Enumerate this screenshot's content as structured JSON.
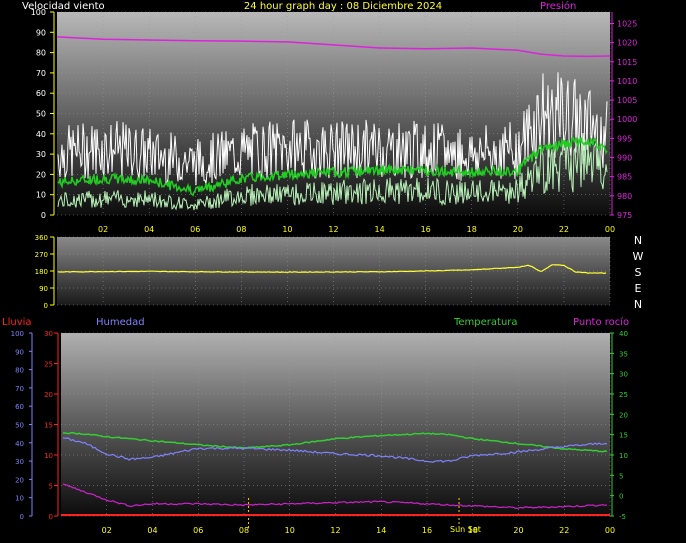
{
  "header": {
    "wind_label": "Velocidad viento",
    "title": "24 hour graph day : 08 Diciembre 2024",
    "pressure_label": "Presión"
  },
  "lower_header": {
    "rain_label": "Lluvia",
    "humidity_label": "Humedad",
    "temperature_label": "Temperatura",
    "dewpoint_label": "Punto rocío"
  },
  "colors": {
    "wind_gust": "#ffffff",
    "wind_avg": "#22cc22",
    "wind_light": "#b8f0b8",
    "pressure": "#dd22dd",
    "direction": "#ffff33",
    "humidity": "#8080ff",
    "temperature": "#33cc33",
    "dewpoint": "#cc22cc",
    "rain": "#ff2222",
    "x_ticks": "#ffff00"
  },
  "x_tick_labels": [
    "02",
    "04",
    "06",
    "08",
    "10",
    "12",
    "14",
    "16",
    "18",
    "20",
    "22",
    "00"
  ],
  "sunset_label": "Sun Set",
  "chart_data": [
    {
      "type": "line",
      "name": "wind-pressure",
      "ylim": [
        0,
        100
      ],
      "y_ticks": [
        0,
        10,
        20,
        30,
        40,
        50,
        60,
        70,
        80,
        90,
        100
      ],
      "y2lim": [
        975,
        1028
      ],
      "y2_ticks": [
        975,
        980,
        985,
        990,
        995,
        1000,
        1005,
        1010,
        1015,
        1020,
        1025
      ],
      "x_hours": [
        0,
        2,
        4,
        6,
        8,
        10,
        12,
        14,
        16,
        18,
        20,
        21,
        22,
        23,
        24
      ],
      "series": [
        {
          "name": "Velocidad viento",
          "role": "gust",
          "values": [
            30,
            33,
            30,
            26,
            31,
            33,
            32,
            33,
            32,
            30,
            32,
            50,
            48,
            45,
            38
          ]
        },
        {
          "name": "",
          "role": "avg",
          "values": [
            16,
            18,
            17,
            12,
            18,
            20,
            21,
            22,
            22,
            21,
            22,
            33,
            35,
            37,
            32
          ]
        },
        {
          "name": "",
          "role": "min",
          "values": [
            7,
            8,
            8,
            5,
            10,
            10,
            11,
            12,
            12,
            11,
            12,
            22,
            24,
            26,
            20
          ]
        },
        {
          "name": "Presión",
          "role": "pressure",
          "values": [
            1021.5,
            1020.9,
            1020.7,
            1020.5,
            1020.4,
            1020.2,
            1019.4,
            1018.6,
            1018.4,
            1018.6,
            1018.0,
            1017.0,
            1016.5,
            1016.4,
            1016.5
          ]
        }
      ]
    },
    {
      "type": "line",
      "name": "wind-direction",
      "ylim": [
        0,
        360
      ],
      "y_ticks": [
        0,
        90,
        180,
        270,
        360
      ],
      "compass_labels": [
        "N",
        "W",
        "S",
        "E",
        "N"
      ],
      "x_hours": [
        0,
        2,
        4,
        6,
        8,
        10,
        12,
        14,
        16,
        18,
        20,
        20.5,
        21,
        21.5,
        22,
        22.5,
        23,
        24
      ],
      "values": [
        175,
        177,
        178,
        176,
        175,
        174,
        175,
        176,
        180,
        186,
        200,
        210,
        175,
        215,
        210,
        175,
        170,
        168
      ]
    },
    {
      "type": "line",
      "name": "humidity-temperature",
      "y_left_lim": [
        0,
        100
      ],
      "y_left_ticks": [
        0,
        10,
        20,
        30,
        40,
        50,
        60,
        70,
        80,
        90,
        100
      ],
      "rain_lim": [
        0,
        30
      ],
      "rain_ticks": [
        0,
        5,
        10,
        15,
        20,
        25,
        30
      ],
      "temp_lim": [
        -5,
        40
      ],
      "temp_ticks": [
        -5,
        0,
        5,
        10,
        15,
        20,
        25,
        30,
        35,
        40
      ],
      "x_hours": [
        0,
        1,
        2,
        3,
        4,
        6,
        8,
        10,
        12,
        14,
        16,
        17,
        18,
        20,
        22,
        24
      ],
      "series": [
        {
          "name": "Humedad",
          "unit": "%",
          "values": [
            43,
            40,
            34,
            31,
            32,
            37,
            37,
            36,
            34,
            33,
            30,
            30,
            33,
            35,
            38,
            40
          ]
        },
        {
          "name": "Temperatura",
          "unit": "°C",
          "values": [
            15.5,
            15.2,
            14.5,
            14.0,
            13.5,
            12.5,
            11.7,
            12.5,
            14.0,
            14.8,
            15.3,
            15.0,
            14.0,
            12.8,
            11.5,
            10.8
          ]
        },
        {
          "name": "Punto rocío",
          "unit": "°C",
          "values": [
            3.0,
            1.0,
            -1.0,
            -2.5,
            -2.0,
            -2.0,
            -2.3,
            -2.0,
            -1.7,
            -1.5,
            -2.0,
            -2.3,
            -2.5,
            -3.0,
            -2.7,
            -2.2
          ]
        },
        {
          "name": "Lluvia",
          "unit": "mm",
          "values": [
            0,
            0,
            0,
            0,
            0,
            0,
            0,
            0,
            0,
            0,
            0,
            0,
            0,
            0,
            0,
            0
          ]
        }
      ],
      "markers_hours": [
        8.2,
        17.4
      ]
    }
  ]
}
